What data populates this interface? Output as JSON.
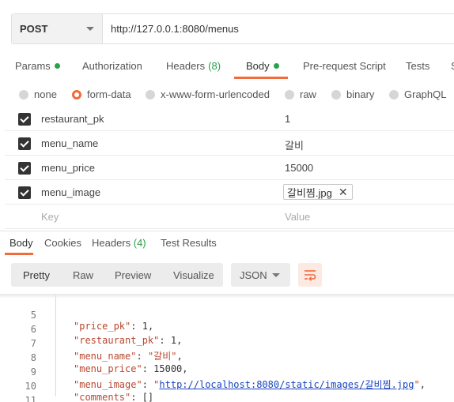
{
  "request": {
    "method": "POST",
    "url": "http://127.0.0.1:8080/menus"
  },
  "request_tabs": [
    {
      "label": "Params",
      "dot": true
    },
    {
      "label": "Authorization"
    },
    {
      "label": "Headers",
      "count": "(8)"
    },
    {
      "label": "Body",
      "dot": true,
      "active": true
    },
    {
      "label": "Pre-request Script"
    },
    {
      "label": "Tests"
    },
    {
      "label": "S"
    }
  ],
  "body_types": [
    {
      "label": "none"
    },
    {
      "label": "form-data",
      "selected": true
    },
    {
      "label": "x-www-form-urlencoded"
    },
    {
      "label": "raw"
    },
    {
      "label": "binary"
    },
    {
      "label": "GraphQL"
    }
  ],
  "form_rows": [
    {
      "key": "restaurant_pk",
      "value": "1"
    },
    {
      "key": "menu_name",
      "value": "갈비"
    },
    {
      "key": "menu_price",
      "value": "15000"
    },
    {
      "key": "menu_image",
      "file": "갈비찜.jpg"
    }
  ],
  "form_placeholder": {
    "key": "Key",
    "value": "Value"
  },
  "response_tabs": [
    {
      "label": "Body",
      "active": true
    },
    {
      "label": "Cookies"
    },
    {
      "label": "Headers ",
      "count": "(4)"
    },
    {
      "label": "Test Results"
    }
  ],
  "view_modes": [
    "Pretty",
    "Raw",
    "Preview",
    "Visualize"
  ],
  "format": "JSON",
  "code_lines": [
    {
      "n": "5",
      "key": "\"price_pk\"",
      "val": "1",
      "type": "num"
    },
    {
      "n": "6",
      "key": "\"restaurant_pk\"",
      "val": "1",
      "type": "num"
    },
    {
      "n": "7",
      "key": "\"menu_name\"",
      "val": "\"갈비\"",
      "type": "str"
    },
    {
      "n": "8",
      "key": "\"menu_price\"",
      "val": "15000",
      "type": "num"
    },
    {
      "n": "9",
      "key": "\"menu_image\"",
      "val": "http://localhost:8080/static/images/갈비찜.jpg",
      "type": "link"
    },
    {
      "n": "10",
      "key": "\"comments\"",
      "val": "[]",
      "type": "plain"
    },
    {
      "n": "11",
      "text": "}"
    }
  ],
  "colors": {
    "accent": "#f26b3a",
    "green": "#2aa14a",
    "string": "#b8472e",
    "link": "#1a44c0"
  }
}
